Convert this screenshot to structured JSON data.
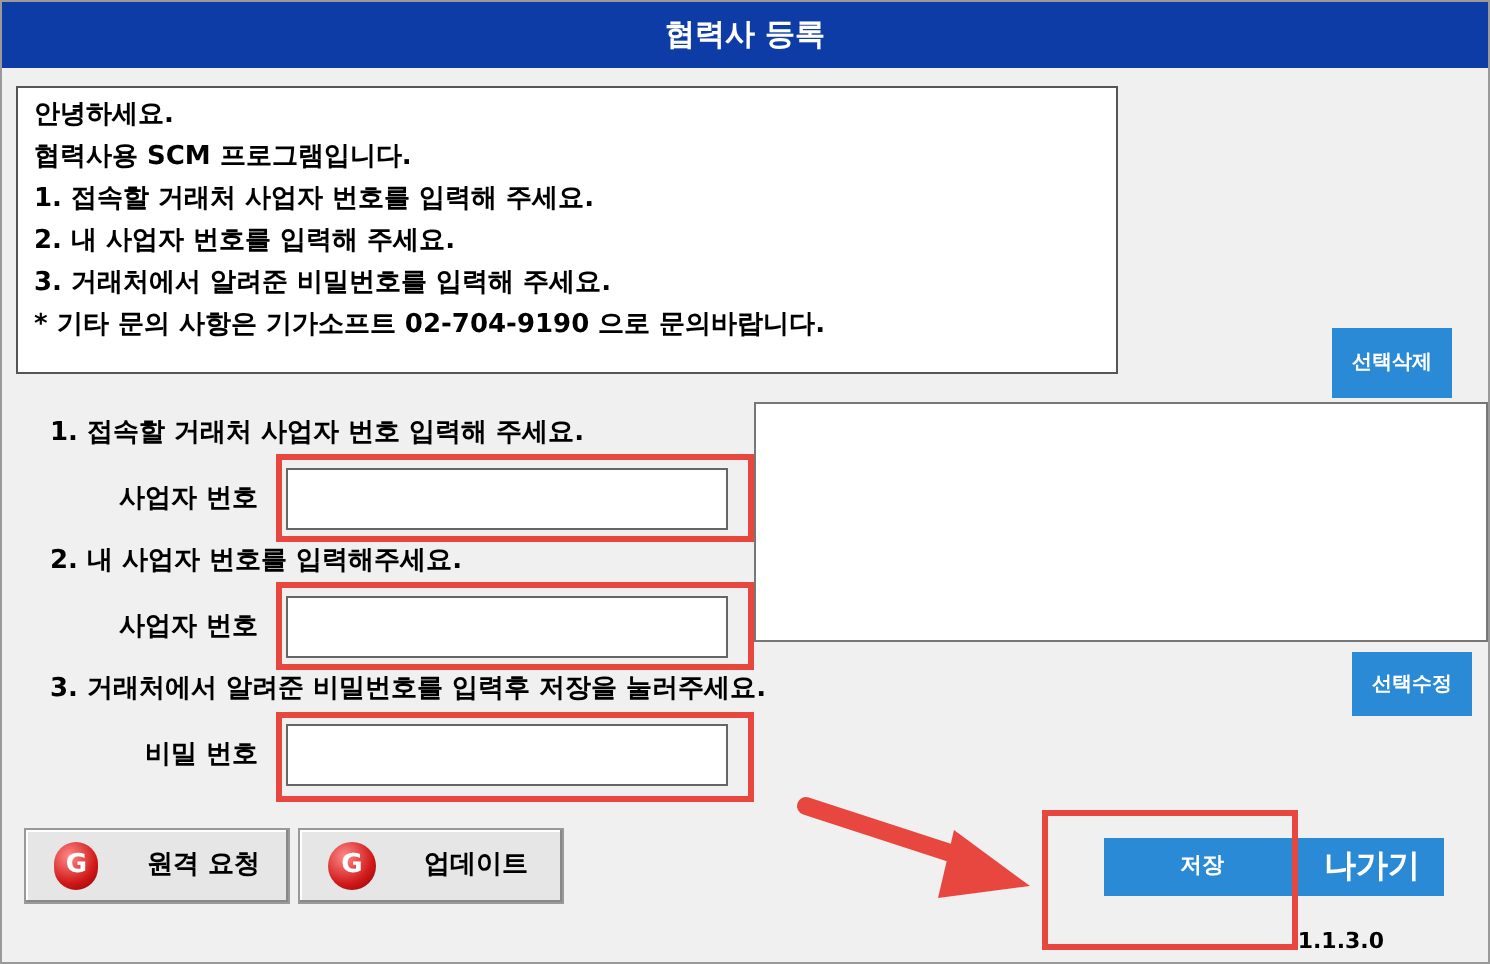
{
  "window": {
    "title": "협력사 등록"
  },
  "notice": {
    "lines": [
      "안녕하세요.",
      "협력사용 SCM 프로그램입니다.",
      "1. 접속할 거래처 사업자 번호를 입력해 주세요.",
      "2. 내 사업자 번호를 입력해 주세요.",
      "3. 거래처에서 알려준 비밀번호를 입력해 주세요.",
      "* 기타 문의 사항은 기가소프트 02-704-9190 으로 문의바랍니다."
    ]
  },
  "delete_button": "선택삭제",
  "steps": [
    {
      "instruction": "1. 접속할 거래처 사업자 번호 입력해 주세요.",
      "label": "사업자 번호"
    },
    {
      "instruction": "2. 내 사업자 번호를 입력해주세요.",
      "label": "사업자 번호"
    },
    {
      "instruction": "3. 거래처에서 알려준 비밀번호를 입력후 저장을 눌러주세요.",
      "label": "비밀 번호"
    }
  ],
  "edit_button": "선택수정",
  "tool_buttons": [
    {
      "label": "원격 요청",
      "icon": "G"
    },
    {
      "label": "업데이트",
      "icon": "G"
    }
  ],
  "save_button": "저장",
  "exit_button": "나가기",
  "version": "1.1.3.0"
}
